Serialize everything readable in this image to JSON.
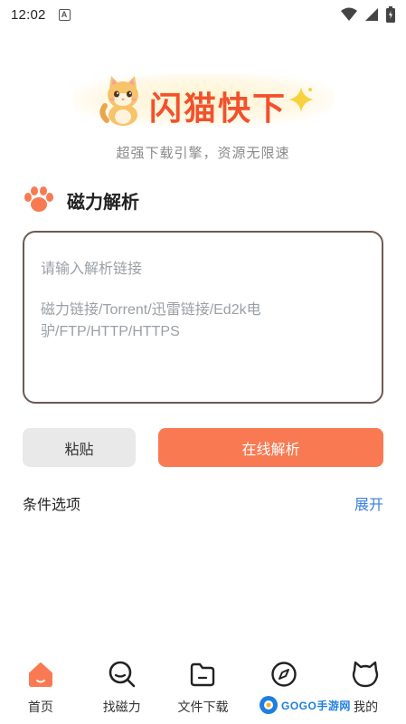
{
  "status_bar": {
    "time": "12:02",
    "notification_icon": "a-icon",
    "wifi_icon": "wifi-icon",
    "signal_icon": "signal-icon",
    "battery_icon": "battery-icon"
  },
  "logo": {
    "title": "闪猫快下",
    "mascot_icon": "cat-mascot-icon",
    "sparkle_icon": "sparkle-icon"
  },
  "tagline": "超强下载引擎，资源无限速",
  "section": {
    "icon": "paw-icon",
    "title": "磁力解析"
  },
  "input": {
    "placeholder_line1": "请输入解析链接",
    "placeholder_line2": "磁力链接/Torrent/迅雷链接/Ed2k电驴/FTP/HTTP/HTTPS"
  },
  "buttons": {
    "paste": "粘贴",
    "parse": "在线解析"
  },
  "options": {
    "label": "条件选项",
    "expand": "展开"
  },
  "nav": {
    "items": [
      {
        "label": "首页",
        "icon": "home-icon",
        "active": true
      },
      {
        "label": "找磁力",
        "icon": "search-icon",
        "active": false
      },
      {
        "label": "文件下载",
        "icon": "folder-icon",
        "active": false
      },
      {
        "label": "",
        "icon": "compass-icon",
        "active": false
      },
      {
        "label": "我的",
        "icon": "cat-face-icon",
        "active": false
      }
    ]
  },
  "colors": {
    "accent": "#f97a52",
    "title_red": "#f2512d",
    "link_blue": "#3a7ee0",
    "input_border": "#6d5a52"
  },
  "watermark": {
    "text": "GOGO手游网"
  }
}
